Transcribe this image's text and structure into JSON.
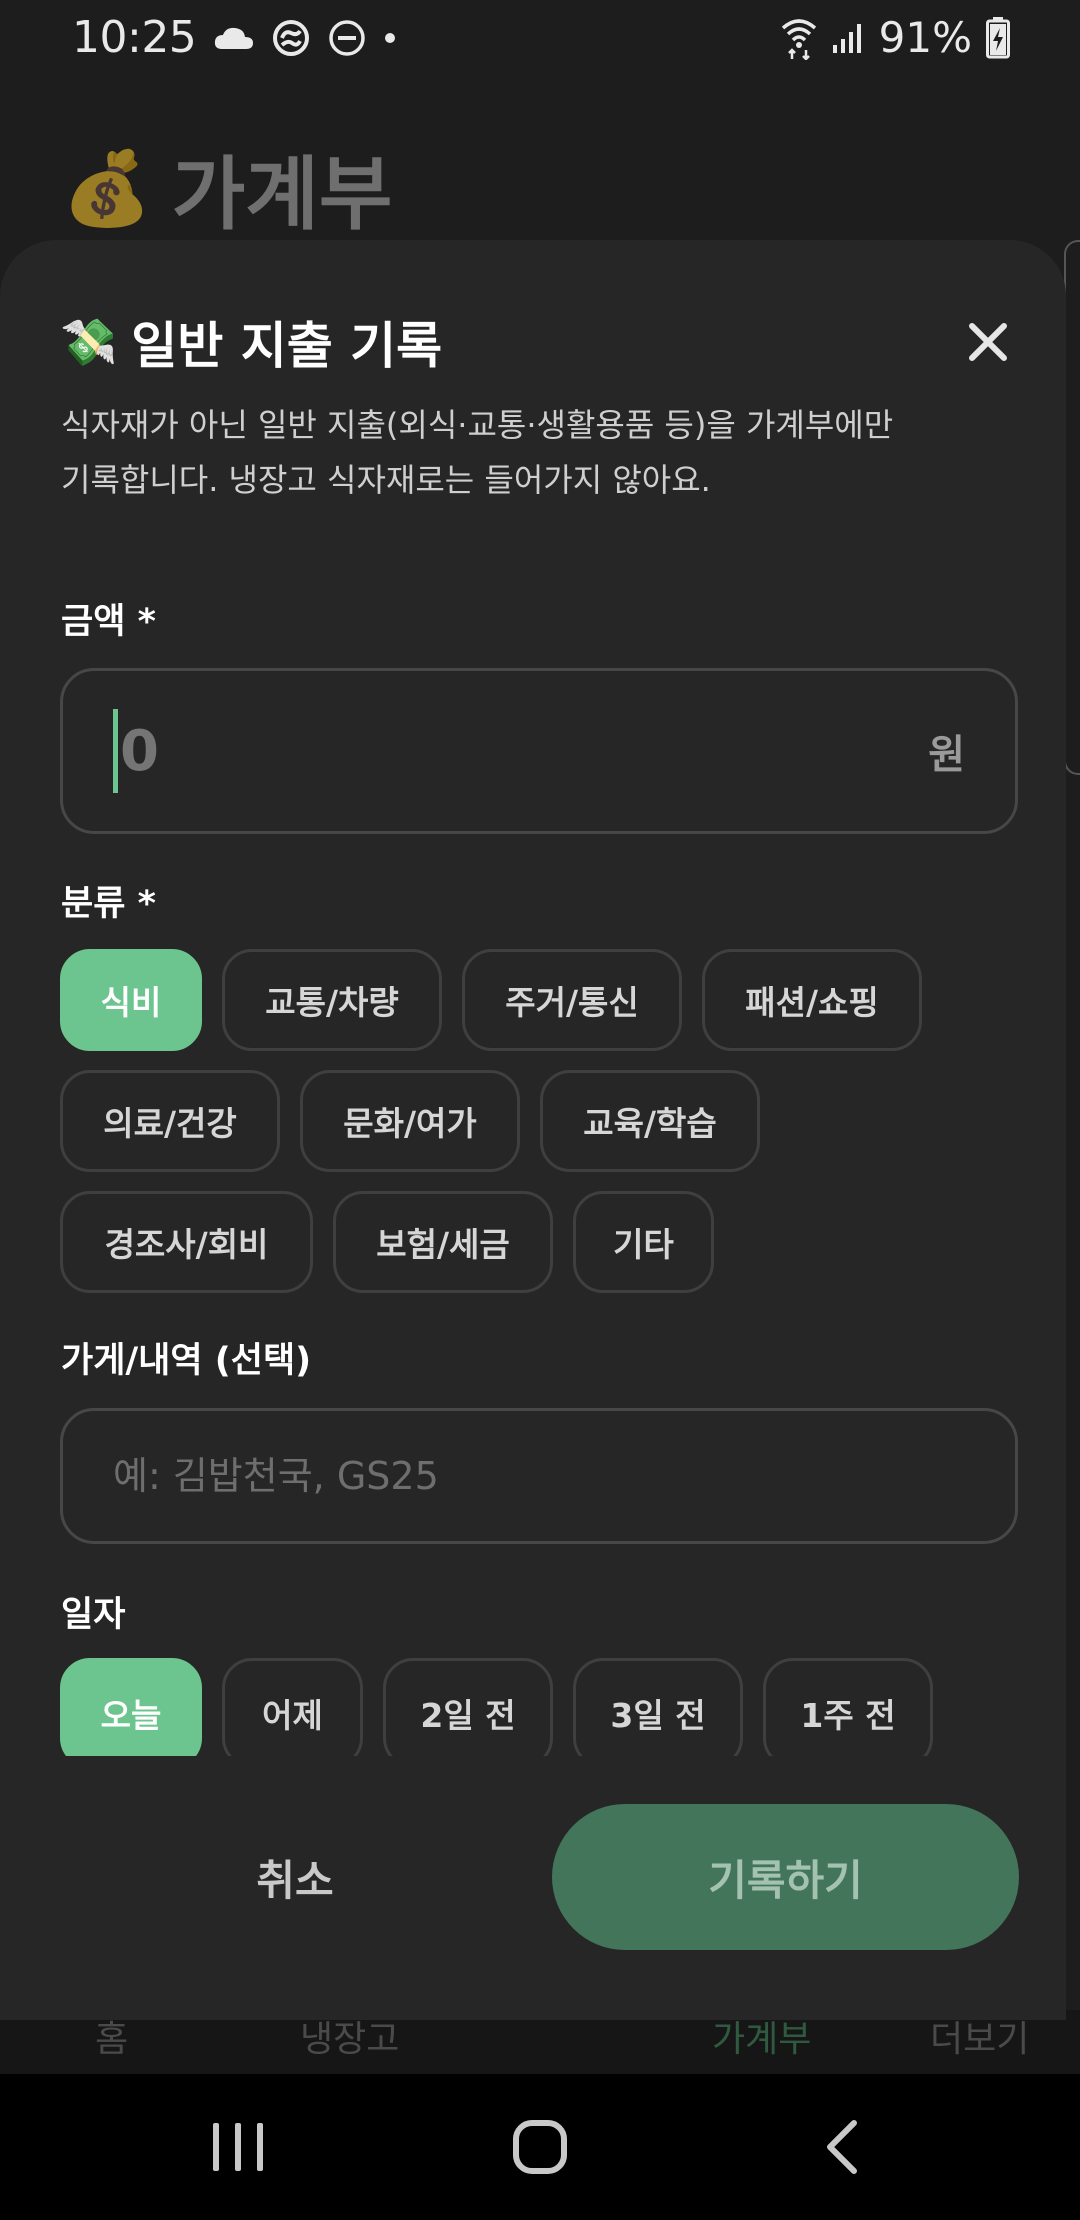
{
  "status_bar": {
    "time": "10:25",
    "battery": "91%",
    "icons": [
      "cloud-icon",
      "sync-icon",
      "do-not-disturb-icon",
      "dot-icon",
      "wifi-icon",
      "signal-icon",
      "battery-charging-icon"
    ]
  },
  "background_app": {
    "title_emoji": "💰",
    "title": "가계부",
    "nav_ghost_labels": [
      "홈",
      "냉장고",
      "가계부",
      "더보기"
    ]
  },
  "sheet": {
    "title_emoji": "💸",
    "title": "일반 지출 기록",
    "description_line1": "식자재가 아닌 일반 지출(외식·교통·생활용품 등)을 가계부에만",
    "description_line2": "기록합니다. 냉장고 식자재로는 들어가지 않아요.",
    "amount": {
      "label": "금액 *",
      "placeholder": "0",
      "unit": "원"
    },
    "category": {
      "label": "분류 *",
      "selected": "식비",
      "rows": [
        [
          "식비",
          "교통/차량",
          "주거/통신",
          "패션/쇼핑"
        ],
        [
          "의료/건강",
          "문화/여가",
          "교육/학습"
        ],
        [
          "경조사/회비",
          "보험/세금",
          "기타"
        ]
      ]
    },
    "store": {
      "label": "가게/내역 (선택)",
      "placeholder": "예: 김밥천국, GS25"
    },
    "date": {
      "label": "일자",
      "selected": "오늘",
      "options": [
        "오늘",
        "어제",
        "2일 전",
        "3일 전",
        "1주 전"
      ]
    },
    "cancel_label": "취소",
    "submit_label": "기록하기"
  },
  "colors": {
    "accent": "#6cc58f",
    "submit_bg": "#43755a",
    "sheet_bg": "#262626",
    "background": "#1d1d1d"
  }
}
